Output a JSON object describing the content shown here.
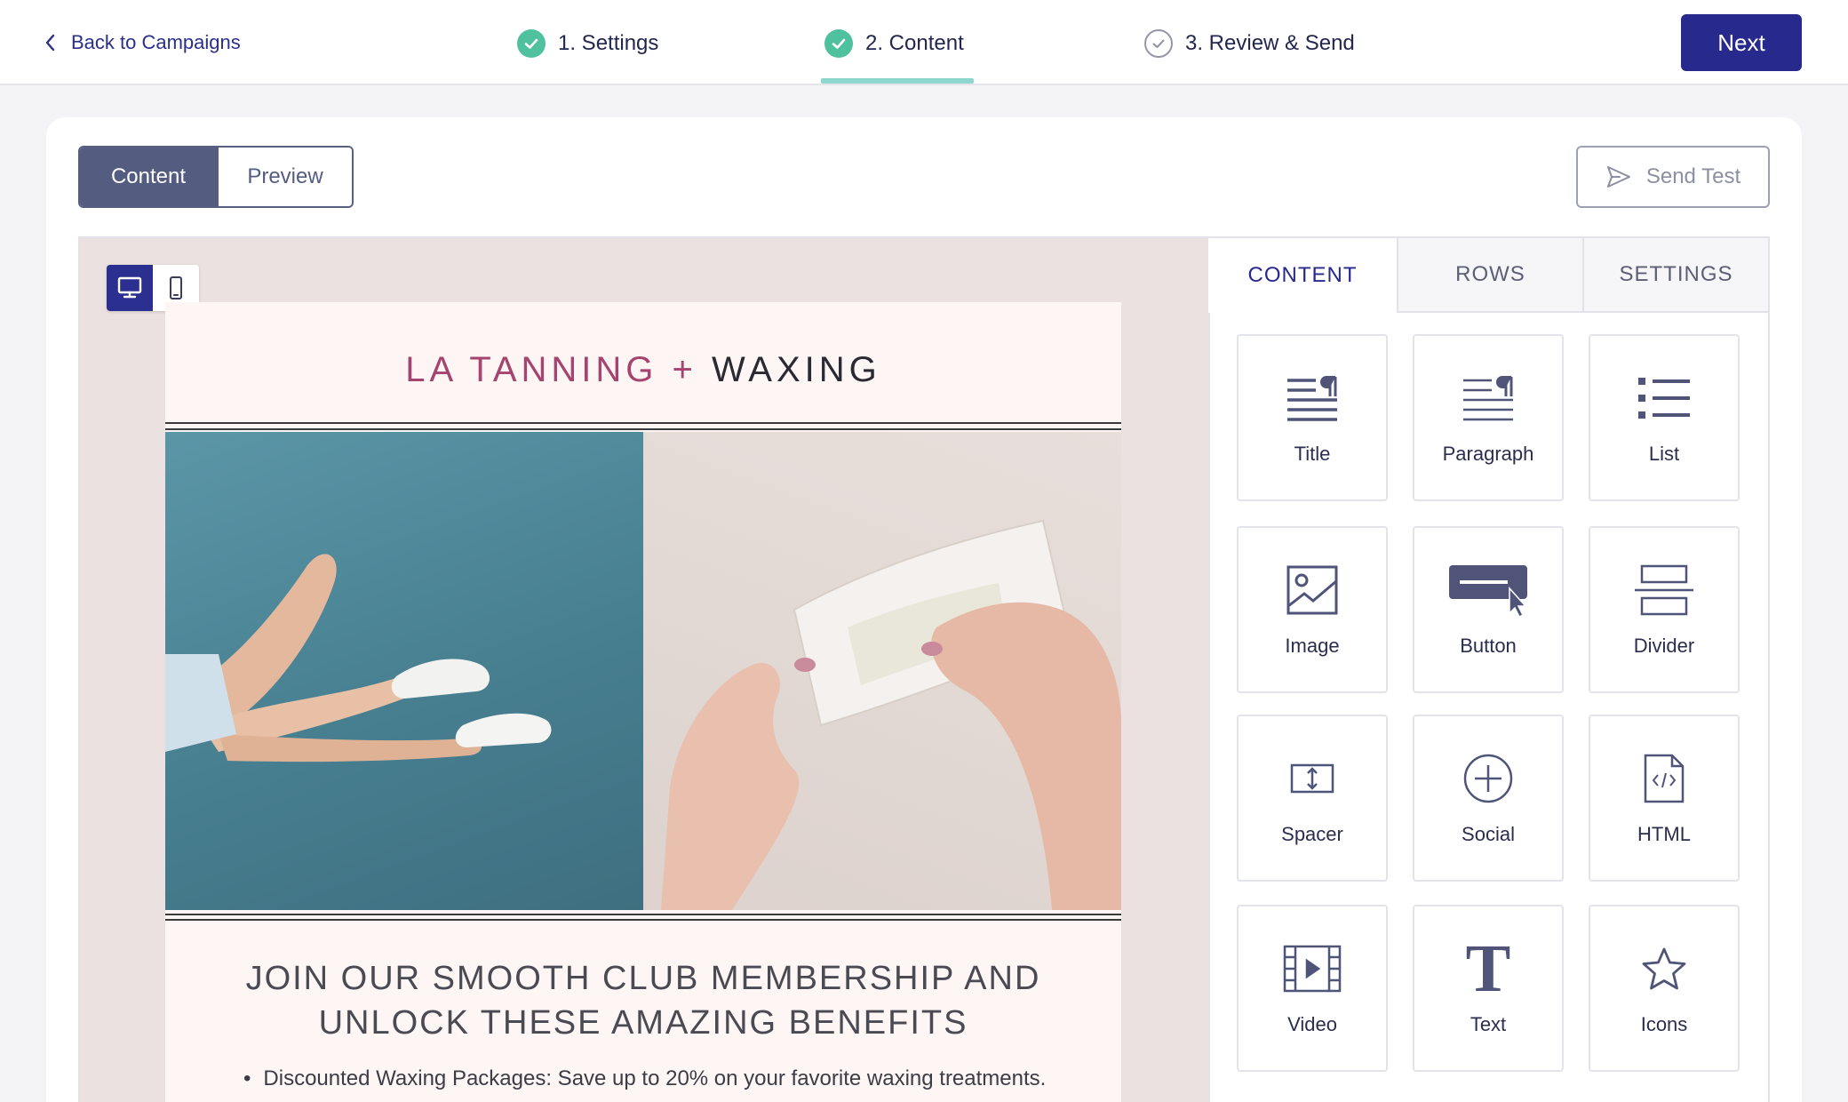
{
  "topbar": {
    "back_label": "Back to Campaigns",
    "steps": [
      {
        "label": "1. Settings",
        "state": "done"
      },
      {
        "label": "2. Content",
        "state": "done"
      },
      {
        "label": "3. Review & Send",
        "state": "todo"
      }
    ],
    "next_label": "Next"
  },
  "toolbar": {
    "view_tabs": [
      "Content",
      "Preview"
    ],
    "active_view": "Content",
    "send_test_label": "Send Test"
  },
  "email": {
    "brand_part1": "LA TANNING +",
    "brand_part2": "WAXING",
    "heading_line1": "JOIN OUR SMOOTH CLUB MEMBERSHIP AND",
    "heading_line2": "UNLOCK THESE AMAZING BENEFITS",
    "bullet": "Discounted Waxing Packages: Save up to 20% on your favorite waxing treatments."
  },
  "panel": {
    "tabs": [
      "CONTENT",
      "ROWS",
      "SETTINGS"
    ],
    "active_tab": "CONTENT",
    "blocks": [
      {
        "label": "Title",
        "icon": "title-icon"
      },
      {
        "label": "Paragraph",
        "icon": "paragraph-icon"
      },
      {
        "label": "List",
        "icon": "list-icon"
      },
      {
        "label": "Image",
        "icon": "image-icon"
      },
      {
        "label": "Button",
        "icon": "button-icon"
      },
      {
        "label": "Divider",
        "icon": "divider-icon"
      },
      {
        "label": "Spacer",
        "icon": "spacer-icon"
      },
      {
        "label": "Social",
        "icon": "social-icon"
      },
      {
        "label": "HTML",
        "icon": "html-icon"
      },
      {
        "label": "Video",
        "icon": "video-icon"
      },
      {
        "label": "Text",
        "icon": "text-icon"
      },
      {
        "label": "Icons",
        "icon": "star-icon"
      }
    ]
  },
  "colors": {
    "primary": "#272a8c",
    "step_done": "#4fc19e",
    "brand_accent": "#a5446f",
    "canvas_bg": "#ebe1e1"
  }
}
